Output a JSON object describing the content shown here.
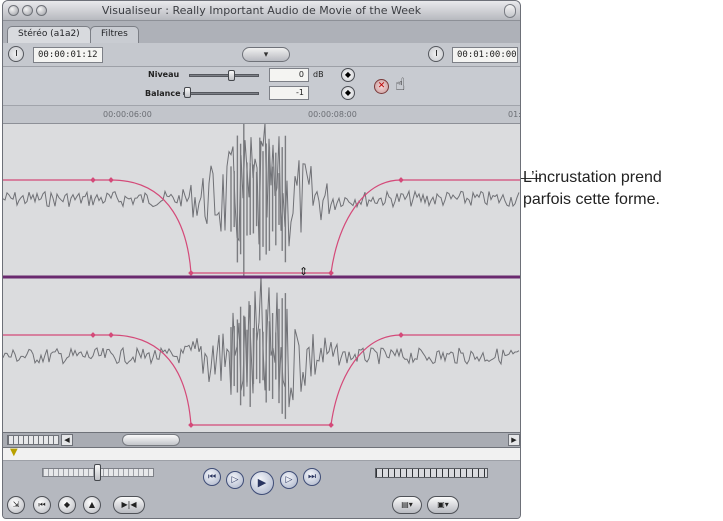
{
  "window": {
    "title": "Visualiseur : Really Important Audio de Movie of the Week"
  },
  "tabs": [
    {
      "label": "Stéréo (a1a2)",
      "active": true
    },
    {
      "label": "Filtres",
      "active": false
    }
  ],
  "timecodes": {
    "left": "00:00:01:12",
    "right": "00:01:00:00"
  },
  "controls": {
    "level_label": "Niveau",
    "level_value": "0",
    "level_unit": "dB",
    "balance_label": "Balance",
    "balance_value": "-1"
  },
  "ruler": {
    "marks": [
      "00:00:06:00",
      "00:00:08:00",
      "01:"
    ]
  },
  "annotation": {
    "line1": "L’incrustation prend",
    "line2": "parfois cette forme."
  },
  "colors": {
    "envelope": "#d44a79",
    "pan_line": "#6a2a6f",
    "waveform": "#6f7075"
  }
}
